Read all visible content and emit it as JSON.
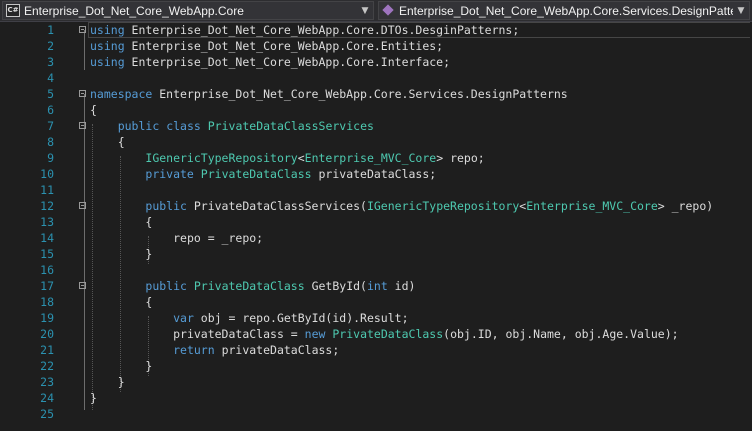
{
  "navbar": {
    "project": "Enterprise_Dot_Net_Core_WebApp.Core",
    "namespace": "Enterprise_Dot_Net_Core_WebApp.Core.Services.DesignPatterns",
    "project_icon": "csharp-project-icon",
    "namespace_icon": "namespace-icon"
  },
  "colors": {
    "keyword": "#569cd6",
    "type": "#4ec9b0",
    "text": "#dcdcdc",
    "line_number": "#2b91af",
    "background": "#1e1e1e"
  },
  "lines": [
    {
      "n": "1",
      "indent": "",
      "tokens": [
        {
          "t": "using",
          "c": "kw"
        },
        {
          "t": " Enterprise_Dot_Net_Core_WebApp.Core.DTOs.DesginPatterns;",
          "c": "tx"
        }
      ]
    },
    {
      "n": "2",
      "indent": "",
      "tokens": [
        {
          "t": "using",
          "c": "kw"
        },
        {
          "t": " Enterprise_Dot_Net_Core_WebApp.Core.Entities;",
          "c": "tx"
        }
      ]
    },
    {
      "n": "3",
      "indent": "",
      "tokens": [
        {
          "t": "using",
          "c": "kw"
        },
        {
          "t": " Enterprise_Dot_Net_Core_WebApp.Core.Interface;",
          "c": "tx"
        }
      ]
    },
    {
      "n": "4",
      "indent": "",
      "tokens": []
    },
    {
      "n": "5",
      "indent": "",
      "tokens": [
        {
          "t": "namespace",
          "c": "kw"
        },
        {
          "t": " Enterprise_Dot_Net_Core_WebApp.Core.Services.DesignPatterns",
          "c": "tx"
        }
      ]
    },
    {
      "n": "6",
      "indent": "",
      "tokens": [
        {
          "t": "{",
          "c": "tx"
        }
      ]
    },
    {
      "n": "7",
      "indent": "    ",
      "tokens": [
        {
          "t": "public",
          "c": "kw"
        },
        {
          "t": " ",
          "c": "tx"
        },
        {
          "t": "class",
          "c": "kw"
        },
        {
          "t": " ",
          "c": "tx"
        },
        {
          "t": "PrivateDataClassServices",
          "c": "ty"
        }
      ]
    },
    {
      "n": "8",
      "indent": "    ",
      "tokens": [
        {
          "t": "{",
          "c": "tx"
        }
      ]
    },
    {
      "n": "9",
      "indent": "        ",
      "tokens": [
        {
          "t": "IGenericTypeRepository",
          "c": "ty"
        },
        {
          "t": "<",
          "c": "tx"
        },
        {
          "t": "Enterprise_MVC_Core",
          "c": "ty"
        },
        {
          "t": "> repo;",
          "c": "tx"
        }
      ]
    },
    {
      "n": "10",
      "indent": "        ",
      "tokens": [
        {
          "t": "private",
          "c": "kw"
        },
        {
          "t": " ",
          "c": "tx"
        },
        {
          "t": "PrivateDataClass",
          "c": "ty"
        },
        {
          "t": " privateDataClass;",
          "c": "tx"
        }
      ]
    },
    {
      "n": "11",
      "indent": "",
      "tokens": []
    },
    {
      "n": "12",
      "indent": "        ",
      "tokens": [
        {
          "t": "public",
          "c": "kw"
        },
        {
          "t": " PrivateDataClassServices(",
          "c": "tx"
        },
        {
          "t": "IGenericTypeRepository",
          "c": "ty"
        },
        {
          "t": "<",
          "c": "tx"
        },
        {
          "t": "Enterprise_MVC_Core",
          "c": "ty"
        },
        {
          "t": "> _repo)",
          "c": "tx"
        }
      ]
    },
    {
      "n": "13",
      "indent": "        ",
      "tokens": [
        {
          "t": "{",
          "c": "tx"
        }
      ]
    },
    {
      "n": "14",
      "indent": "            ",
      "tokens": [
        {
          "t": "repo = _repo;",
          "c": "tx"
        }
      ]
    },
    {
      "n": "15",
      "indent": "        ",
      "tokens": [
        {
          "t": "}",
          "c": "tx"
        }
      ]
    },
    {
      "n": "16",
      "indent": "",
      "tokens": []
    },
    {
      "n": "17",
      "indent": "        ",
      "tokens": [
        {
          "t": "public",
          "c": "kw"
        },
        {
          "t": " ",
          "c": "tx"
        },
        {
          "t": "PrivateDataClass",
          "c": "ty"
        },
        {
          "t": " GetById(",
          "c": "tx"
        },
        {
          "t": "int",
          "c": "kw"
        },
        {
          "t": " id)",
          "c": "tx"
        }
      ]
    },
    {
      "n": "18",
      "indent": "        ",
      "tokens": [
        {
          "t": "{",
          "c": "tx"
        }
      ]
    },
    {
      "n": "19",
      "indent": "            ",
      "tokens": [
        {
          "t": "var",
          "c": "kw"
        },
        {
          "t": " obj = repo.GetById(id).Result;",
          "c": "tx"
        }
      ]
    },
    {
      "n": "20",
      "indent": "            ",
      "tokens": [
        {
          "t": "privateDataClass = ",
          "c": "tx"
        },
        {
          "t": "new",
          "c": "kw"
        },
        {
          "t": " ",
          "c": "tx"
        },
        {
          "t": "PrivateDataClass",
          "c": "ty"
        },
        {
          "t": "(obj.ID, obj.Name, obj.Age.Value);",
          "c": "tx"
        }
      ]
    },
    {
      "n": "21",
      "indent": "            ",
      "tokens": [
        {
          "t": "return",
          "c": "kw"
        },
        {
          "t": " privateDataClass;",
          "c": "tx"
        }
      ]
    },
    {
      "n": "22",
      "indent": "        ",
      "tokens": [
        {
          "t": "}",
          "c": "tx"
        }
      ]
    },
    {
      "n": "23",
      "indent": "    ",
      "tokens": [
        {
          "t": "}",
          "c": "tx"
        }
      ]
    },
    {
      "n": "24",
      "indent": "",
      "tokens": [
        {
          "t": "}",
          "c": "tx"
        }
      ]
    },
    {
      "n": "25",
      "indent": "",
      "tokens": []
    }
  ]
}
